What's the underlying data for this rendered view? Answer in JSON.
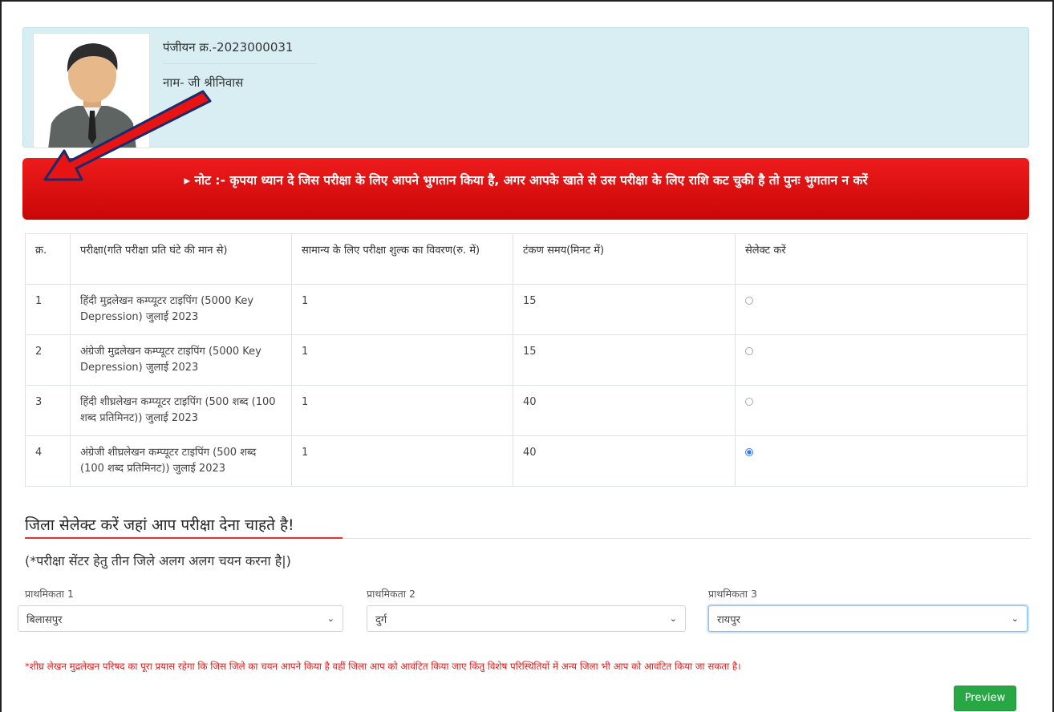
{
  "profile": {
    "registration": "पंजीयन क्र.-2023000031",
    "name": "नाम- जी श्रीनिवास"
  },
  "notice": "▸ नोट :- कृपया ध्यान दे जिस परीक्षा के लिए आपने भुगतान किया है, अगर आपके खाते से उस परीक्षा के लिए राशि कट चुकी है तो पुनः भुगतान न करें",
  "table": {
    "headers": [
      "क्र.",
      "परीक्षा(गति परीक्षा प्रति घंटे की मान से)",
      "सामान्य के लिए परीक्षा शुल्क का विवरण(रु. में)",
      "टंकण समय(मिनट में)",
      "सेलेक्ट करें"
    ],
    "rows": [
      {
        "no": "1",
        "exam": "हिंदी मुद्रलेखन कम्प्यूटर टाइपिंग (5000 Key Depression) जुलाई 2023",
        "fee": "1",
        "time": "15",
        "selected": false
      },
      {
        "no": "2",
        "exam": "अंग्रेजी मुद्रलेखन कम्प्यूटर टाइपिंग (5000 Key Depression) जुलाई 2023",
        "fee": "1",
        "time": "15",
        "selected": false
      },
      {
        "no": "3",
        "exam": "हिंदी शीघ्रलेखन कम्प्यूटर टाइपिंग (500 शब्द (100 शब्द प्रतिमिनट)) जुलाई 2023",
        "fee": "1",
        "time": "40",
        "selected": false
      },
      {
        "no": "4",
        "exam": "अंग्रेजी शीघ्रलेखन कम्प्यूटर टाइपिंग (500 शब्द (100 शब्द प्रतिमिनट)) जुलाई 2023",
        "fee": "1",
        "time": "40",
        "selected": true
      }
    ]
  },
  "district": {
    "title": "जिला सेलेक्ट करें जहां आप परीक्षा देना चाहते है!",
    "note": "(*परीक्षा सेंटर हेतु तीन जिले अलग अलग चयन करना है|)",
    "priorities": [
      {
        "label": "प्राथमिकता 1",
        "value": "बिलासपुर"
      },
      {
        "label": "प्राथमिकता 2",
        "value": "दुर्ग"
      },
      {
        "label": "प्राथमिकता 3",
        "value": "रायपुर"
      }
    ]
  },
  "footnote": "*शीघ्र लेखन मुद्रलेखन परिषद का पूरा प्रयास रहेगा कि जिस जिले का चयन आपने किया है वहीं जिला आप को आवंटित किया जाए किंतु विशेष परिस्थितियों में अन्य जिला भी आप को आवंटित किया जा सकता है।",
  "preview_label": "Preview",
  "colors": {
    "alert": "#dd1111",
    "profile_bg": "#d9eef3",
    "preview": "#28a745",
    "accent": "#e53131"
  }
}
